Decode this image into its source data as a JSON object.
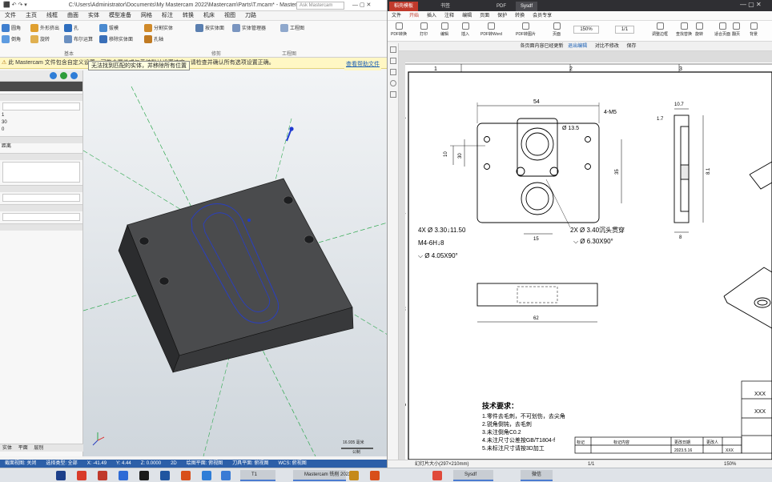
{
  "left_app": {
    "title": "C:\\Users\\Administrator\\Documents\\My Mastercam 2022\\Mastercam\\Parts\\T.mcam* - Mastercam 铣削 2022",
    "search_placeholder": "Ask Mastercam",
    "menu": [
      "文件",
      "主页",
      "线框",
      "曲面",
      "实体",
      "模型准备",
      "网格",
      "标注",
      "转换",
      "机床",
      "视图",
      "刀路"
    ],
    "ribbon_labels": [
      "圆角",
      "倒角",
      "外形挤出",
      "旋转",
      "孔",
      "布尔运算",
      "拔模",
      "移除实体面",
      "分割实体",
      "孔轴",
      "按实体面",
      "实体管理器",
      "工程图"
    ],
    "ribbon_groups": [
      "基本",
      "修剪",
      "工程图"
    ],
    "warning": "此 Mastercam 文件包含自定义设置，可能会覆盖或与系统默认设置冲突。请检查并确认所有选项设置正确。",
    "warning_link": "查看帮助文件",
    "tooltip": "无法找到匹配的实体，并移除所有位置",
    "panel": {
      "accept_colors": [
        "#2e7dd7",
        "#2e9d3a",
        "#2e7dd7"
      ],
      "rows": [
        "1",
        "30",
        "0",
        "距离"
      ]
    },
    "status": {
      "items": [
        "截面视图: 关闭",
        "选择类型: 全部",
        "X: -41.49",
        "Y: 4.44",
        "Z: 0.0000",
        "2D",
        "绘图平面: 俯视图",
        "刀具平面: 俯视图",
        "WCS: 俯视图"
      ]
    },
    "scale_label": "16.935 毫米",
    "scale_unit": "公制",
    "tabs_bottom": [
      "实体",
      "平面",
      "层别"
    ]
  },
  "right_app": {
    "tabs": [
      "稻壳模板",
      "书签",
      "PDF",
      "Sysdf"
    ],
    "menu": [
      "文件",
      "开始",
      "插入",
      "注释",
      "编辑",
      "页面",
      "保护",
      "转换",
      "会员专享"
    ],
    "toolbar": [
      "PDF转换",
      "打印",
      "编辑",
      "插入",
      "PDF转Word",
      "PDF转图片",
      "页面",
      "调整边框",
      "查找替换",
      "旋转",
      "适合页面",
      "翻页",
      "背景"
    ],
    "zoom": "150%",
    "page_indicator": "1/1",
    "infobar": [
      "各页面内容已经更新",
      "退出编辑",
      "比较",
      "对比不修改",
      "保存"
    ],
    "status_left": "幻灯片大小(297×210mm)",
    "status_zoom": "150%"
  },
  "drawing": {
    "col_labels": [
      "1",
      "2",
      "3"
    ],
    "row_labels": [
      "A",
      "B",
      "C",
      "D"
    ],
    "dims": [
      "54",
      "4-M5",
      "Ø 13.5",
      "10",
      "30",
      "35",
      "15",
      "10.7",
      "1.7",
      "8",
      "62",
      "8.1"
    ],
    "hole_note_1": "4X Ø 3.30↓11.50",
    "hole_note_2": "M4-6H↓8",
    "hole_note_3": "⌵ Ø 4.05X90°",
    "csk_note_1": "2X Ø 3.40沉头贯穿",
    "csk_note_2": "⌵ Ø 6.30X90°",
    "tech_title": "技术要求：",
    "tech_items": [
      "1.零件去毛刺，不可划伤，去尖角",
      "2.锐角倒钝，去毛刺",
      "3.未注倒角C0.2",
      "4.未注尺寸公差按GB/T1804-f",
      "5.未标注尺寸请按3D加工"
    ],
    "title_block": [
      "标记",
      "处数",
      "更改文件号",
      "签名",
      "日期",
      "标记内容",
      "更改日期",
      "更改人",
      "2023.5.16",
      "XXX",
      "XXX"
    ]
  },
  "taskbar": {
    "apps": [
      "T1",
      "Mastercam 铣削 2022",
      "PDF",
      "Sysdf",
      "微信"
    ],
    "icon_colors": [
      "#1c3f8a",
      "#d83b2a",
      "#c0392b",
      "#2e6bd6",
      "#1a1a1a",
      "#2055a0",
      "#d84f1a",
      "#2e7dd7",
      "#3a7bd5",
      "#c58a1a",
      "#d84f1a",
      "#e04a3a"
    ]
  }
}
